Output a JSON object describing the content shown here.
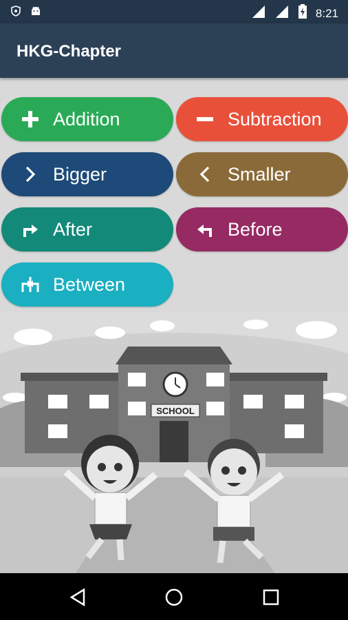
{
  "status_bar": {
    "time": "8:21"
  },
  "app_bar": {
    "title": "HKG-Chapter"
  },
  "buttons": [
    {
      "label": "Addition",
      "icon": "plus-icon",
      "color": "#2aaa57"
    },
    {
      "label": "Subtraction",
      "icon": "minus-icon",
      "color": "#e8503a"
    },
    {
      "label": "Bigger",
      "icon": "chevron-right-icon",
      "color": "#1d4a78"
    },
    {
      "label": "Smaller",
      "icon": "chevron-left-icon",
      "color": "#8a6a38"
    },
    {
      "label": "After",
      "icon": "arrow-right-turn-icon",
      "color": "#13897a"
    },
    {
      "label": "Before",
      "icon": "arrow-left-turn-icon",
      "color": "#962a63"
    },
    {
      "label": "Between",
      "icon": "arrows-between-icon",
      "color": "#1aafc1"
    }
  ],
  "illustration": {
    "sign_text": "SCHOOL"
  }
}
